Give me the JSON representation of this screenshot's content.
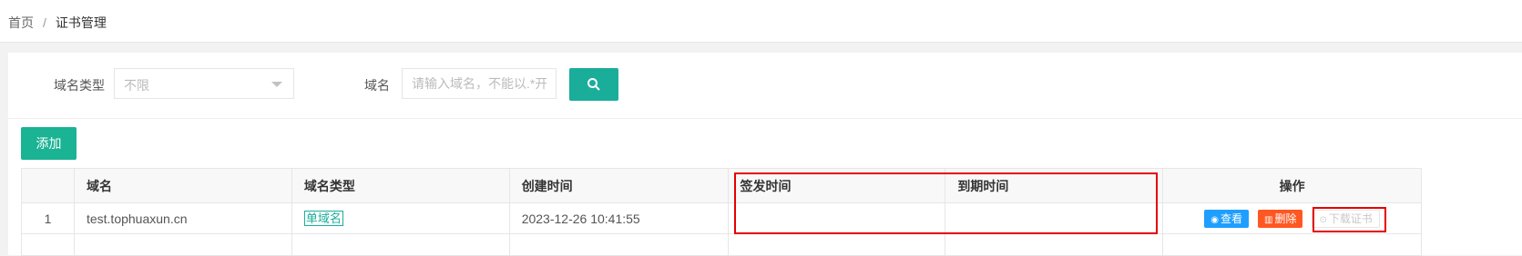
{
  "breadcrumb": {
    "home": "首页",
    "separator": "/",
    "current": "证书管理"
  },
  "filters": {
    "domain_type_label": "域名类型",
    "domain_type_value": "不限",
    "domain_label": "域名",
    "domain_placeholder": "请输入域名，不能以.*开头"
  },
  "buttons": {
    "add": "添加"
  },
  "table": {
    "columns": [
      "",
      "域名",
      "域名类型",
      "创建时间",
      "签发时间",
      "到期时间",
      "操作"
    ],
    "rows": [
      {
        "index": "1",
        "domain": "test.tophuaxun.cn",
        "type": "单域名",
        "created": "2023-12-26 10:41:55",
        "issued": "",
        "expires": "",
        "actions": {
          "view": "查看",
          "delete": "删除",
          "download": "下载证书"
        }
      }
    ]
  },
  "colors": {
    "accent": "#1aad9a",
    "view": "#1e9fff",
    "delete": "#ff5722",
    "highlight": "#e50000"
  }
}
